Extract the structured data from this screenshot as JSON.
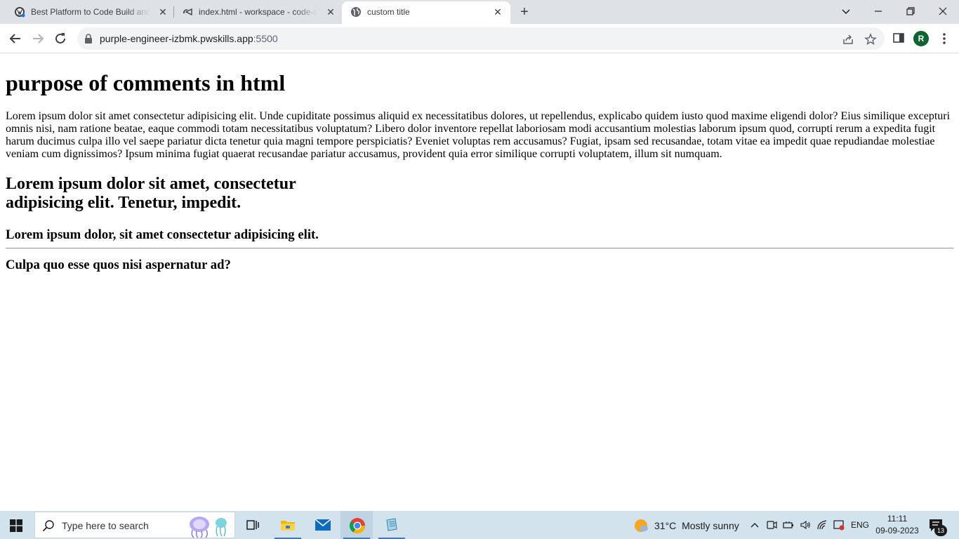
{
  "browser": {
    "tabs": [
      {
        "title": "Best Platform to Code Build and Deploy",
        "icon": "wordpress-icon"
      },
      {
        "title": "index.html - workspace - code-server",
        "icon": "code-server-icon"
      },
      {
        "title": "custom title",
        "icon": "globe-icon"
      }
    ],
    "new_tab_label": "+",
    "url_host": "purple-engineer-izbmk.pwskills.app",
    "url_port": ":5500",
    "profile_initial": "R"
  },
  "page": {
    "heading": "purpose of comments in html",
    "paragraph": "Lorem ipsum dolor sit amet consectetur adipisicing elit. Unde cupiditate possimus aliquid ex necessitatibus dolores, ut repellendus, explicabo quidem iusto quod maxime eligendi dolor? Eius similique excepturi omnis nisi, nam ratione beatae, eaque commodi totam necessitatibus voluptatum? Libero dolor inventore repellat laboriosam modi accusantium molestias laborum ipsum quod, corrupti rerum a expedita fugit harum ducimus culpa illo vel saepe pariatur dicta tenetur quia magni tempore perspiciatis? Eveniet voluptas rem accusamus? Fugiat, ipsam sed recusandae, totam vitae ea impedit quae repudiandae molestiae veniam cum dignissimos? Ipsum minima fugiat quaerat recusandae pariatur accusamus, provident quia error similique corrupti voluptatem, illum sit numquam.",
    "subheading": "Lorem ipsum dolor sit amet, consectetur adipisicing elit. Tenetur, impedit.",
    "heading3": "Lorem ipsum dolor, sit amet consectetur adipisicing elit.",
    "heading4": "Culpa quo esse quos nisi aspernatur ad?"
  },
  "taskbar": {
    "search_placeholder": "Type here to search",
    "weather_temp": "31°C",
    "weather_desc": "Mostly sunny",
    "language": "ENG",
    "time": "11:11",
    "date": "09-09-2023",
    "notification_count": "13",
    "apps": [
      "task-view-icon",
      "file-explorer-icon",
      "mail-icon",
      "chrome-icon",
      "notepad-icon"
    ]
  },
  "colors": {
    "tabstrip_bg": "#dee1e6",
    "taskbar_bg": "#d3e3ee",
    "avatar_bg": "#0d652d",
    "accent": "#3a7ac4"
  }
}
